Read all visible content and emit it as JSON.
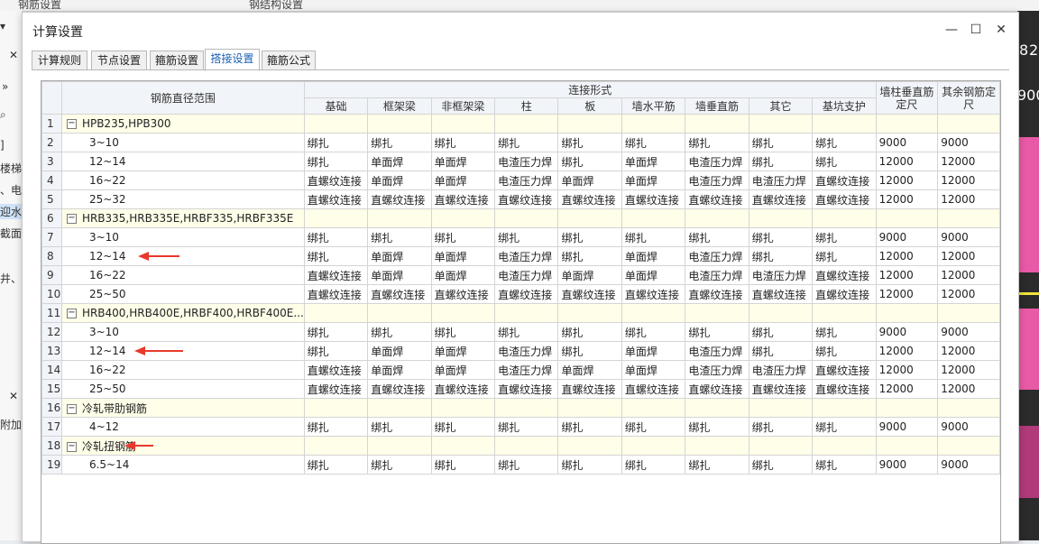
{
  "background": {
    "top_labels": [
      "钢筋设置",
      "钢结构设置"
    ],
    "left_labels": [
      "▾",
      "✕",
      "»",
      "⌕",
      "]",
      "楼梯",
      "、电",
      "迎水",
      "截面]",
      "井、",
      "✕",
      "附加"
    ],
    "right_numbers": [
      "8",
      "2",
      "900"
    ]
  },
  "dialog": {
    "title": "计算设置",
    "minimize_glyph": "—",
    "maximize_glyph": "☐",
    "close_glyph": "✕"
  },
  "tabs": [
    {
      "label": "计算规则",
      "active": false
    },
    {
      "label": "节点设置",
      "active": false
    },
    {
      "label": "箍筋设置",
      "active": false
    },
    {
      "label": "搭接设置",
      "active": true
    },
    {
      "label": "箍筋公式",
      "active": false
    }
  ],
  "table": {
    "header_range": "钢筋直径范围",
    "header_group": "连接形式",
    "header_wall_vertical": "墙柱垂直筋定尺",
    "header_other_length": "其余钢筋定尺",
    "columns": [
      "基础",
      "框架梁",
      "非框架梁",
      "柱",
      "板",
      "墙水平筋",
      "墙垂直筋",
      "其它",
      "基坑支护"
    ],
    "rows": [
      {
        "n": "1",
        "group": true,
        "name": "HPB235,HPB300"
      },
      {
        "n": "2",
        "name": "3~10",
        "cells": [
          "绑扎",
          "绑扎",
          "绑扎",
          "绑扎",
          "绑扎",
          "绑扎",
          "绑扎",
          "绑扎",
          "绑扎",
          "9000",
          "9000"
        ]
      },
      {
        "n": "3",
        "name": "12~14",
        "cells": [
          "绑扎",
          "单面焊",
          "单面焊",
          "电渣压力焊",
          "绑扎",
          "单面焊",
          "电渣压力焊",
          "绑扎",
          "绑扎",
          "12000",
          "12000"
        ]
      },
      {
        "n": "4",
        "name": "16~22",
        "cells": [
          "直螺纹连接",
          "单面焊",
          "单面焊",
          "电渣压力焊",
          "单面焊",
          "单面焊",
          "电渣压力焊",
          "电渣压力焊",
          "直螺纹连接",
          "12000",
          "12000"
        ]
      },
      {
        "n": "5",
        "name": "25~32",
        "cells": [
          "直螺纹连接",
          "直螺纹连接",
          "直螺纹连接",
          "直螺纹连接",
          "直螺纹连接",
          "直螺纹连接",
          "直螺纹连接",
          "直螺纹连接",
          "直螺纹连接",
          "12000",
          "12000"
        ]
      },
      {
        "n": "6",
        "group": true,
        "name": "HRB335,HRB335E,HRBF335,HRBF335E"
      },
      {
        "n": "7",
        "name": "3~10",
        "cells": [
          "绑扎",
          "绑扎",
          "绑扎",
          "绑扎",
          "绑扎",
          "绑扎",
          "绑扎",
          "绑扎",
          "绑扎",
          "9000",
          "9000"
        ]
      },
      {
        "n": "8",
        "name": "12~14",
        "cells": [
          "绑扎",
          "单面焊",
          "单面焊",
          "电渣压力焊",
          "绑扎",
          "单面焊",
          "电渣压力焊",
          "绑扎",
          "绑扎",
          "12000",
          "12000"
        ]
      },
      {
        "n": "9",
        "name": "16~22",
        "cells": [
          "直螺纹连接",
          "单面焊",
          "单面焊",
          "电渣压力焊",
          "单面焊",
          "单面焊",
          "电渣压力焊",
          "电渣压力焊",
          "直螺纹连接",
          "12000",
          "12000"
        ]
      },
      {
        "n": "10",
        "name": "25~50",
        "cells": [
          "直螺纹连接",
          "直螺纹连接",
          "直螺纹连接",
          "直螺纹连接",
          "直螺纹连接",
          "直螺纹连接",
          "直螺纹连接",
          "直螺纹连接",
          "直螺纹连接",
          "12000",
          "12000"
        ]
      },
      {
        "n": "11",
        "group": true,
        "name": "HRB400,HRB400E,HRBF400,HRBF400E..."
      },
      {
        "n": "12",
        "name": "3~10",
        "cells": [
          "绑扎",
          "绑扎",
          "绑扎",
          "绑扎",
          "绑扎",
          "绑扎",
          "绑扎",
          "绑扎",
          "绑扎",
          "9000",
          "9000"
        ]
      },
      {
        "n": "13",
        "name": "12~14",
        "cells": [
          "绑扎",
          "单面焊",
          "单面焊",
          "电渣压力焊",
          "绑扎",
          "单面焊",
          "电渣压力焊",
          "绑扎",
          "绑扎",
          "12000",
          "12000"
        ]
      },
      {
        "n": "14",
        "name": "16~22",
        "cells": [
          "直螺纹连接",
          "单面焊",
          "单面焊",
          "电渣压力焊",
          "单面焊",
          "单面焊",
          "电渣压力焊",
          "电渣压力焊",
          "直螺纹连接",
          "12000",
          "12000"
        ]
      },
      {
        "n": "15",
        "name": "25~50",
        "cells": [
          "直螺纹连接",
          "直螺纹连接",
          "直螺纹连接",
          "直螺纹连接",
          "直螺纹连接",
          "直螺纹连接",
          "直螺纹连接",
          "直螺纹连接",
          "直螺纹连接",
          "12000",
          "12000"
        ]
      },
      {
        "n": "16",
        "group": true,
        "name": "冷轧带肋钢筋"
      },
      {
        "n": "17",
        "name": "4~12",
        "cells": [
          "绑扎",
          "绑扎",
          "绑扎",
          "绑扎",
          "绑扎",
          "绑扎",
          "绑扎",
          "绑扎",
          "绑扎",
          "9000",
          "9000"
        ]
      },
      {
        "n": "18",
        "group": true,
        "name": "冷轧扭钢筋"
      },
      {
        "n": "19",
        "name": "6.5~14",
        "cells": [
          "绑扎",
          "绑扎",
          "绑扎",
          "绑扎",
          "绑扎",
          "绑扎",
          "绑扎",
          "绑扎",
          "绑扎",
          "9000",
          "9000"
        ]
      }
    ],
    "expand_glyph": "−"
  },
  "annotations": {
    "arrow_color": "#e8392b"
  }
}
